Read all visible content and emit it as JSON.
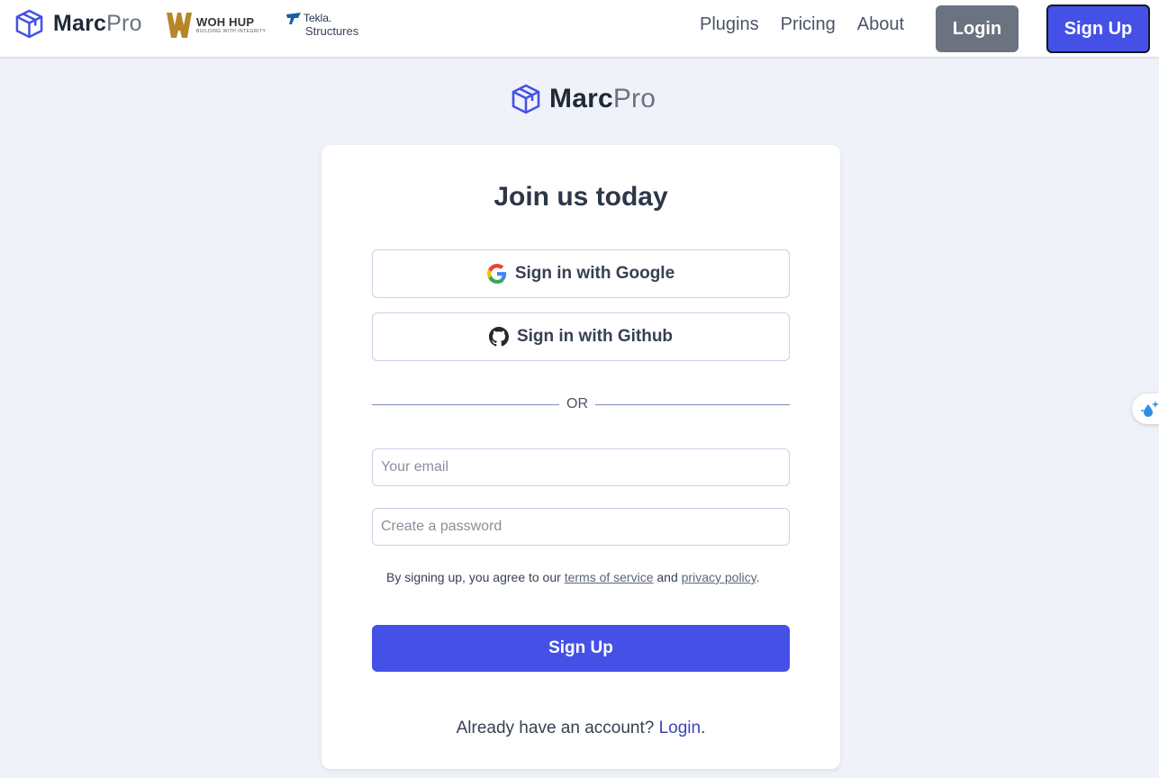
{
  "brand": {
    "name_strong": "Marc",
    "name_light": "Pro"
  },
  "partners": {
    "woh_hup": {
      "name": "WOH HUP",
      "tagline": "BUILDING WITH INTEGRITY"
    },
    "tekla": {
      "name": "Tekla.",
      "sub": "Structures"
    }
  },
  "nav": {
    "links": [
      "Plugins",
      "Pricing",
      "About"
    ],
    "login_label": "Login",
    "signup_label": "Sign Up"
  },
  "form": {
    "title": "Join us today",
    "google_label": "Sign in with Google",
    "github_label": "Sign in with Github",
    "divider": "OR",
    "email_placeholder": "Your email",
    "email_value": "",
    "password_placeholder": "Create a password",
    "password_value": "",
    "terms_prefix": "By signing up, you agree to our ",
    "terms_link": "terms of service",
    "terms_and": " and ",
    "privacy_link": "privacy policy",
    "terms_suffix": ".",
    "submit_label": "Sign Up",
    "login_prompt": "Already have an account? ",
    "login_link": "Login",
    "login_suffix": "."
  },
  "colors": {
    "accent": "#4551e6",
    "background": "#f0f2fa",
    "login_button": "#6b7280"
  },
  "icons": [
    "cube-logo-icon",
    "woh-hup-logo",
    "tekla-logo",
    "google-icon",
    "github-icon",
    "water-drop-sparkle-icon"
  ]
}
